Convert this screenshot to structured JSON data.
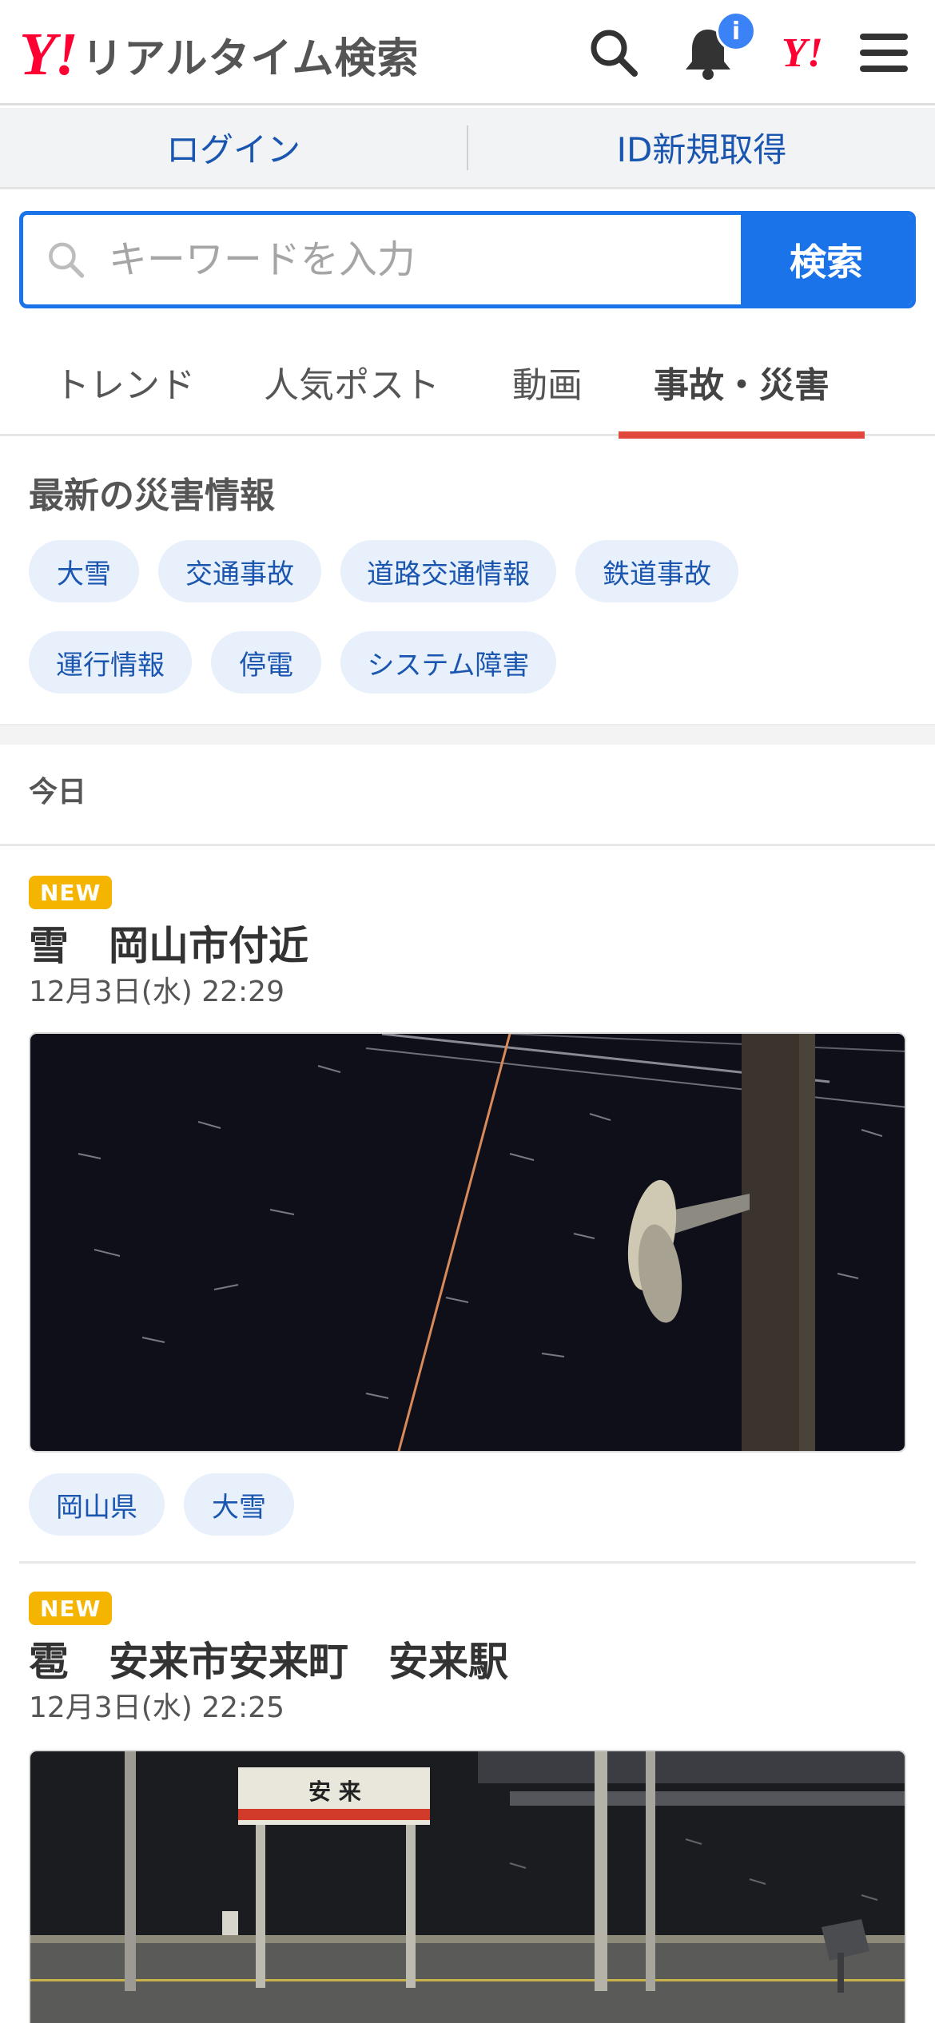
{
  "header": {
    "logo_mark": "Y!",
    "logo_text": "リアルタイム検索",
    "notification_badge": "i",
    "yahoo_mark": "Y!",
    "icons": [
      "search-icon",
      "bell-icon",
      "yahoo-japan-icon",
      "hamburger-menu-icon"
    ]
  },
  "login_bar": {
    "login": "ログイン",
    "register": "ID新規取得"
  },
  "search": {
    "placeholder": "キーワードを入力",
    "button": "検索"
  },
  "tabs": [
    {
      "label": "トレンド",
      "active": false
    },
    {
      "label": "人気ポスト",
      "active": false
    },
    {
      "label": "動画",
      "active": false
    },
    {
      "label": "事故・災害",
      "active": true
    }
  ],
  "disaster": {
    "title": "最新の災害情報",
    "chips": [
      "大雪",
      "交通事故",
      "道路交通情報",
      "鉄道事故",
      "運行情報",
      "停電",
      "システム障害"
    ]
  },
  "day_label": "今日",
  "posts": [
    {
      "badge": "NEW",
      "title": "雪　岡山市付近",
      "time": "12月3日(水) 22:29",
      "tags": [
        "岡山県",
        "大雪"
      ]
    },
    {
      "badge": "NEW",
      "title": "雹　安来市安来町　安来駅",
      "time": "12月3日(水) 22:25",
      "sign_text": "安 来"
    }
  ],
  "colors": {
    "brand_red": "#ff0033",
    "accent_blue": "#1a73e8",
    "link_blue": "#1a56b0",
    "tab_underline": "#e0473d",
    "new_badge": "#f5b400"
  }
}
